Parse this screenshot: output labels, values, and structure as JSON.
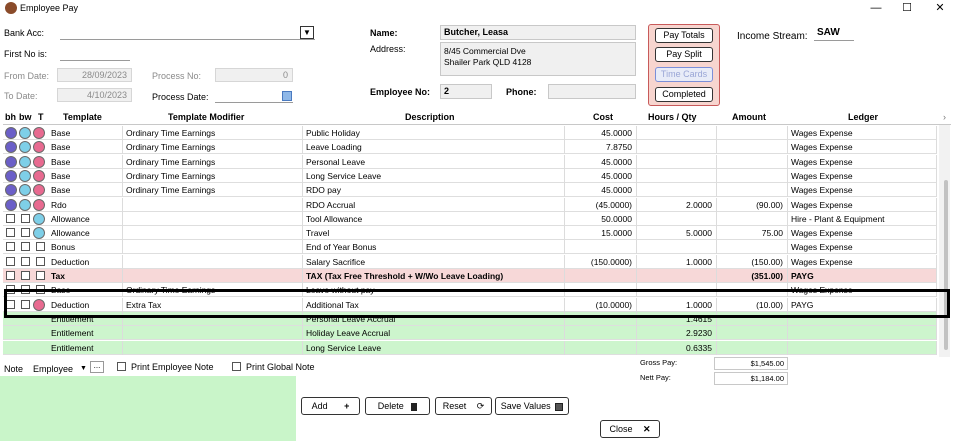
{
  "window": {
    "title": "Employee Pay",
    "minimize": "—",
    "maximize": "☐",
    "close": "✕"
  },
  "header": {
    "bank_acc_label": "Bank Acc:",
    "first_no_label": "First No is:",
    "from_date_label": "From Date:",
    "from_date_value": "28/09/2023",
    "to_date_label": "To Date:",
    "to_date_value": "4/10/2023",
    "process_no_label": "Process No:",
    "process_no_value": "0",
    "process_date_label": "Process Date:",
    "name_label": "Name:",
    "name_value": "Butcher, Leasa",
    "address_label": "Address:",
    "address_line1": "8/45 Commercial Dve",
    "address_line2": "Shailer Park QLD 4128",
    "employee_no_label": "Employee No:",
    "employee_no_value": "2",
    "phone_label": "Phone:",
    "income_stream_label": "Income Stream:",
    "income_stream_value": "SAW"
  },
  "pay_buttons": {
    "pay_totals": "Pay Totals",
    "pay_split": "Pay Split",
    "time_cards": "Time Cards",
    "completed": "Completed"
  },
  "grid": {
    "columns": {
      "bh": "bh",
      "bw": "bw",
      "t": "T",
      "template": "Template",
      "modifier": "Template Modifier",
      "description": "Description",
      "cost": "Cost",
      "hours": "Hours / Qty",
      "amount": "Amount",
      "ledger": "Ledger"
    },
    "rows": [
      {
        "kind": "normal",
        "dots": true,
        "template": "Base",
        "modifier": "Ordinary Time Earnings",
        "description": "Public Holiday",
        "cost": "45.0000",
        "hours": "",
        "amount": "",
        "ledger": "Wages Expense"
      },
      {
        "kind": "normal",
        "dots": true,
        "template": "Base",
        "modifier": "Ordinary Time Earnings",
        "description": "Leave Loading",
        "cost": "7.8750",
        "hours": "",
        "amount": "",
        "ledger": "Wages Expense"
      },
      {
        "kind": "normal",
        "dots": true,
        "template": "Base",
        "modifier": "Ordinary Time Earnings",
        "description": "Personal Leave",
        "cost": "45.0000",
        "hours": "",
        "amount": "",
        "ledger": "Wages Expense"
      },
      {
        "kind": "normal",
        "dots": true,
        "template": "Base",
        "modifier": "Ordinary Time Earnings",
        "description": "Long Service Leave",
        "cost": "45.0000",
        "hours": "",
        "amount": "",
        "ledger": "Wages Expense"
      },
      {
        "kind": "normal",
        "dots": true,
        "template": "Base",
        "modifier": "Ordinary Time Earnings",
        "description": "RDO pay",
        "cost": "45.0000",
        "hours": "",
        "amount": "",
        "ledger": "Wages Expense"
      },
      {
        "kind": "normal",
        "dots": true,
        "template": "Rdo",
        "modifier": "",
        "description": "RDO Accrual",
        "cost": "(45.0000)",
        "hours": "2.0000",
        "amount": "(90.00)",
        "ledger": "Wages Expense"
      },
      {
        "kind": "normal",
        "dots": false,
        "template": "Allowance",
        "modifier": "",
        "description": "Tool Allowance",
        "cost": "50.0000",
        "hours": "",
        "amount": "",
        "ledger": "Hire - Plant & Equipment"
      },
      {
        "kind": "normal",
        "dots": false,
        "template": "Allowance",
        "modifier": "",
        "description": "Travel",
        "cost": "15.0000",
        "hours": "5.0000",
        "amount": "75.00",
        "ledger": "Wages Expense"
      },
      {
        "kind": "normal",
        "dots": false,
        "template": "Bonus",
        "modifier": "",
        "description": "End of Year Bonus",
        "cost": "",
        "hours": "",
        "amount": "",
        "ledger": "Wages Expense"
      },
      {
        "kind": "normal",
        "dots": false,
        "template": "Deduction",
        "modifier": "",
        "description": "Salary Sacrifice",
        "cost": "(150.0000)",
        "hours": "1.0000",
        "amount": "(150.00)",
        "ledger": "Wages Expense"
      },
      {
        "kind": "tax",
        "dots": false,
        "template": "Tax",
        "modifier": "",
        "description": "TAX (Tax Free Threshold  + W/Wo Leave Loading)",
        "cost": "",
        "hours": "",
        "amount": "(351.00)",
        "ledger": "PAYG"
      },
      {
        "kind": "normal",
        "dots": false,
        "template": "Base",
        "modifier": "Ordinary Time Earnings",
        "description": "Leave without pay",
        "cost": "",
        "hours": "",
        "amount": "",
        "ledger": "Wages Expense"
      },
      {
        "kind": "normal",
        "dots": false,
        "template": "Deduction",
        "modifier": "Extra Tax",
        "description": "Additional Tax",
        "cost": "(10.0000)",
        "hours": "1.0000",
        "amount": "(10.00)",
        "ledger": "PAYG"
      },
      {
        "kind": "ent",
        "dots": false,
        "template": "Entitlement",
        "modifier": "",
        "description": "Personal Leave Accrual",
        "cost": "",
        "hours": "1.4615",
        "amount": "",
        "ledger": ""
      },
      {
        "kind": "ent",
        "dots": false,
        "template": "Entitlement",
        "modifier": "",
        "description": "Holiday Leave Accrual",
        "cost": "",
        "hours": "2.9230",
        "amount": "",
        "ledger": ""
      },
      {
        "kind": "ent",
        "dots": false,
        "template": "Entitlement",
        "modifier": "",
        "description": "Long Service Leave",
        "cost": "",
        "hours": "0.6335",
        "amount": "",
        "ledger": ""
      }
    ]
  },
  "footer": {
    "note_label": "Note",
    "note_type": "Employee",
    "note_ellipsis": "...",
    "print_employee_note": "Print Employee Note",
    "print_global_note": "Print Global Note",
    "gross_pay_label": "Gross Pay:",
    "gross_pay_value": "$1,545.00",
    "nett_pay_label": "Nett Pay:",
    "nett_pay_value": "$1,184.00"
  },
  "actions": {
    "add": "Add",
    "delete": "Delete",
    "reset": "Reset",
    "save_values": "Save Values",
    "close": "Close"
  }
}
